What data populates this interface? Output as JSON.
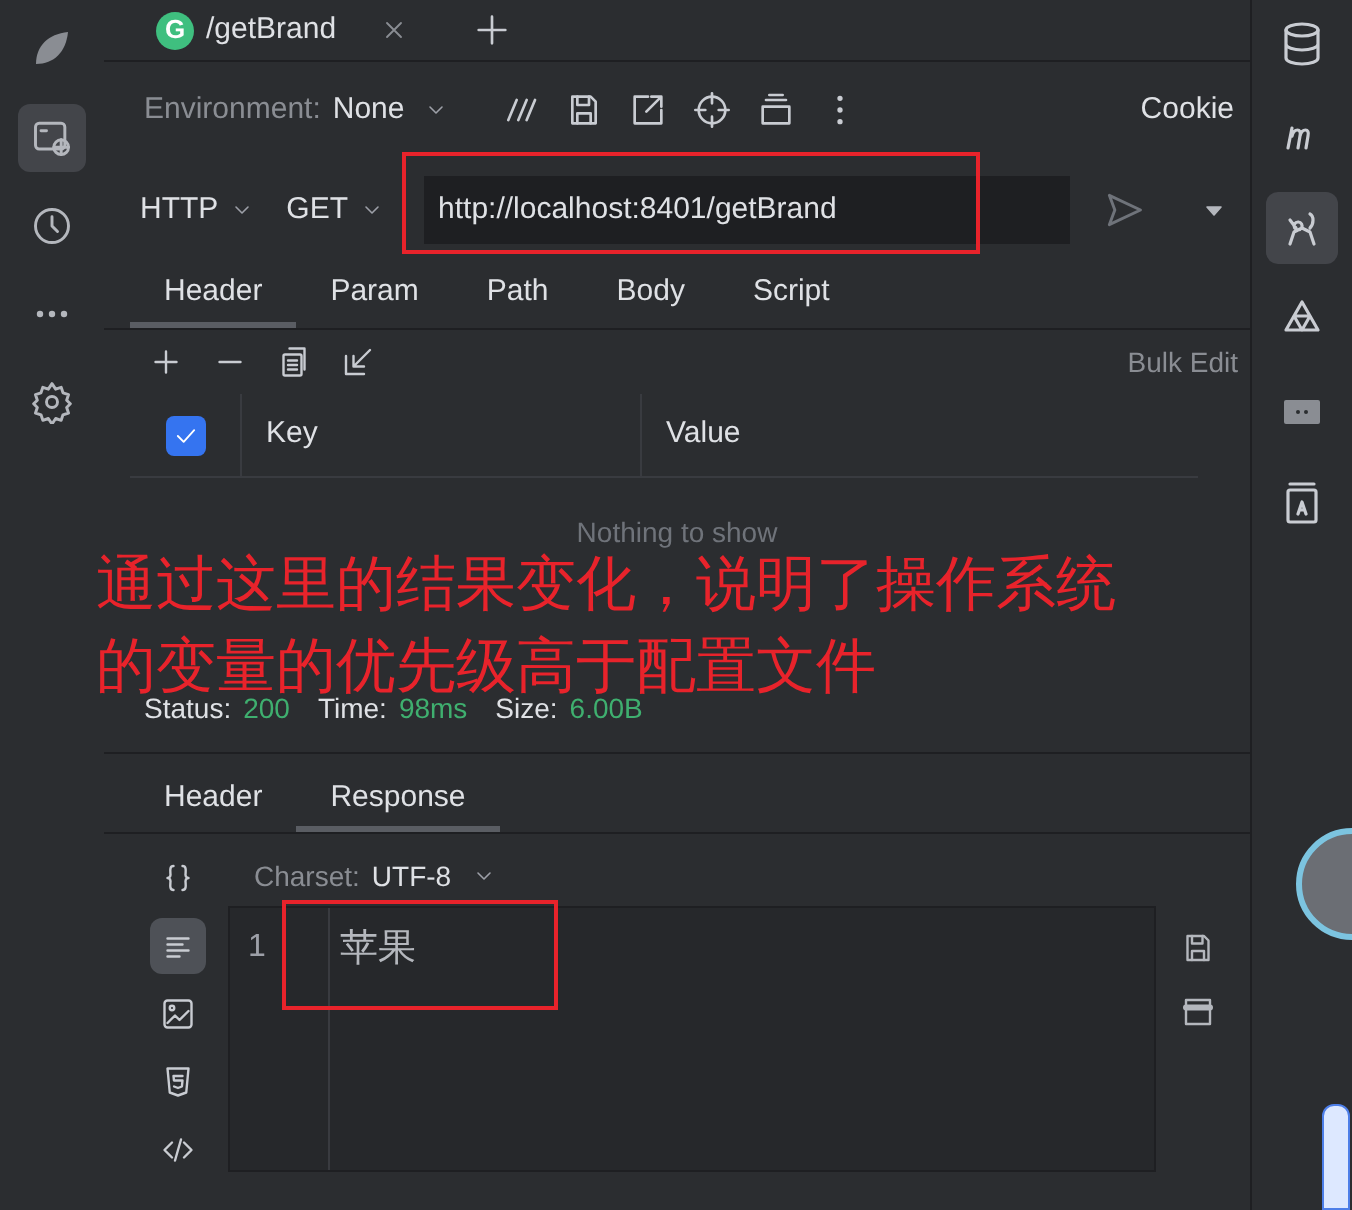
{
  "request_tab": {
    "badge": "G",
    "title": "/getBrand"
  },
  "environment": {
    "label": "Environment:",
    "value": "None"
  },
  "cookie": "Cookie",
  "request": {
    "protocol": "HTTP",
    "method": "GET",
    "url": "http://localhost:8401/getBrand"
  },
  "request_tabs": [
    {
      "label": "Header",
      "selected": true
    },
    {
      "label": "Param",
      "selected": false
    },
    {
      "label": "Path",
      "selected": false
    },
    {
      "label": "Body",
      "selected": false
    },
    {
      "label": "Script",
      "selected": false
    }
  ],
  "bulk_edit": "Bulk Edit",
  "table": {
    "all_checked": true,
    "columns": [
      "Key",
      "Value"
    ],
    "empty_text": "Nothing to show"
  },
  "annotation_lines": [
    "通过这里的结果变化，说明了操作系统",
    "的变量的优先级高于配置文件"
  ],
  "status": [
    {
      "label": "Status:",
      "value": "200"
    },
    {
      "label": "Time:",
      "value": "98ms"
    },
    {
      "label": "Size:",
      "value": "6.00B"
    }
  ],
  "response_tabs": [
    {
      "label": "Header",
      "selected": false
    },
    {
      "label": "Response",
      "selected": true
    }
  ],
  "charset": {
    "label": "Charset:",
    "value": "UTF-8"
  },
  "view_modes": [
    {
      "kind": "json",
      "selected": false
    },
    {
      "kind": "text",
      "selected": true
    },
    {
      "kind": "image",
      "selected": false
    },
    {
      "kind": "html",
      "selected": false
    },
    {
      "kind": "code",
      "selected": false
    }
  ],
  "editor": {
    "lines": [
      {
        "number": "1",
        "text": "苹果"
      }
    ]
  },
  "left_rail": [
    {
      "kind": "globe",
      "selected": true
    },
    {
      "kind": "clock",
      "selected": false
    },
    {
      "kind": "more",
      "selected": false
    },
    {
      "kind": "gear",
      "selected": false
    }
  ],
  "right_rail": [
    {
      "kind": "database",
      "selected": false
    },
    {
      "kind": "m",
      "selected": false
    },
    {
      "kind": "animal",
      "selected": true
    },
    {
      "kind": "shape",
      "selected": false
    },
    {
      "kind": "screen",
      "selected": false
    },
    {
      "kind": "book",
      "selected": false
    }
  ]
}
